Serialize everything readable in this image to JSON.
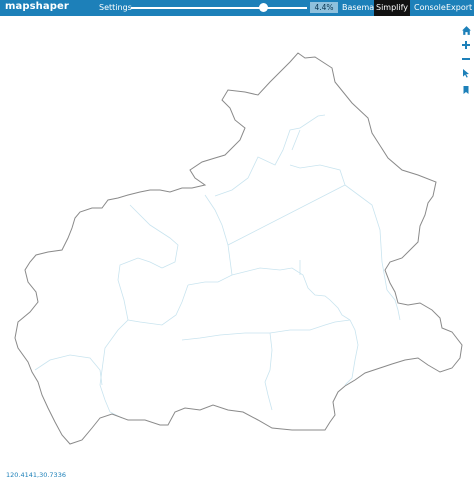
{
  "app": {
    "logo": "mapshaper"
  },
  "menu": {
    "settings": "Settings",
    "basemap": "Basemap",
    "simplify": "Simplify",
    "console": "Console",
    "export": "Export"
  },
  "simplify": {
    "percent": "4.4%",
    "slider_fraction": 0.75
  },
  "map_tools": [
    "home-icon",
    "zoom-in-icon",
    "zoom-out-icon",
    "pointer-select-icon",
    "bookmark-icon"
  ],
  "coords": "120.4141,30.7336",
  "colors": {
    "topbar": "#1d80b9",
    "active_tab": "#111111",
    "outline": "#8a8a8a",
    "inner_boundary": "#c9e4ef",
    "coords_text": "#1d80b9"
  }
}
